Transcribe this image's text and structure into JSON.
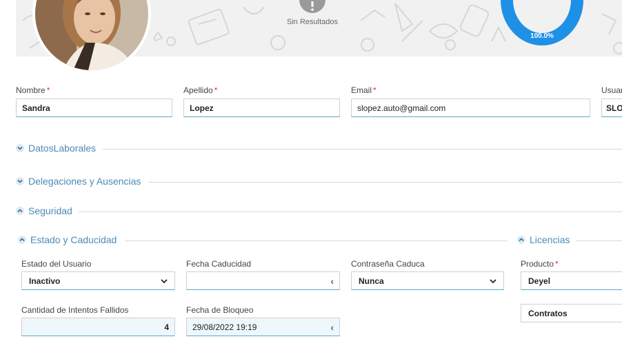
{
  "header": {
    "no_results": "Sin Resultados",
    "progress_label": "100.0%",
    "progress_value": 1.0,
    "accent": "#1e90e6"
  },
  "user_fields": {
    "nombre_label": "Nombre",
    "nombre_value": "Sandra",
    "apellido_label": "Apellido",
    "apellido_value": "Lopez",
    "email_label": "Email",
    "email_value": "slopez.auto@gmail.com",
    "usuario_label": "Usuar",
    "usuario_value": "SLO",
    "required_mark": "*"
  },
  "sections": {
    "datos_laborales": "DatosLaborales",
    "delegaciones": "Delegaciones y Ausencias",
    "seguridad": "Seguridad",
    "estado_caducidad": "Estado y Caducidad",
    "licencias": "Licencias"
  },
  "estado": {
    "estado_usuario_label": "Estado del Usuario",
    "estado_usuario_value": "Inactivo",
    "fecha_caducidad_label": "Fecha Caducidad",
    "fecha_caducidad_value": "",
    "contrasena_label": "Contraseña Caduca",
    "contrasena_value": "Nunca",
    "intentos_label": "Cantidad de Intentos Fallidos",
    "intentos_value": "4",
    "fecha_bloqueo_label": "Fecha de Bloqueo",
    "fecha_bloqueo_value": "29/08/2022 19:19"
  },
  "licencias": {
    "producto_label": "Producto",
    "producto_value": "Deyel",
    "contratos_value": "Contratos"
  },
  "icons": {
    "select_chevron": "⌄",
    "date_arrow": "‹"
  }
}
